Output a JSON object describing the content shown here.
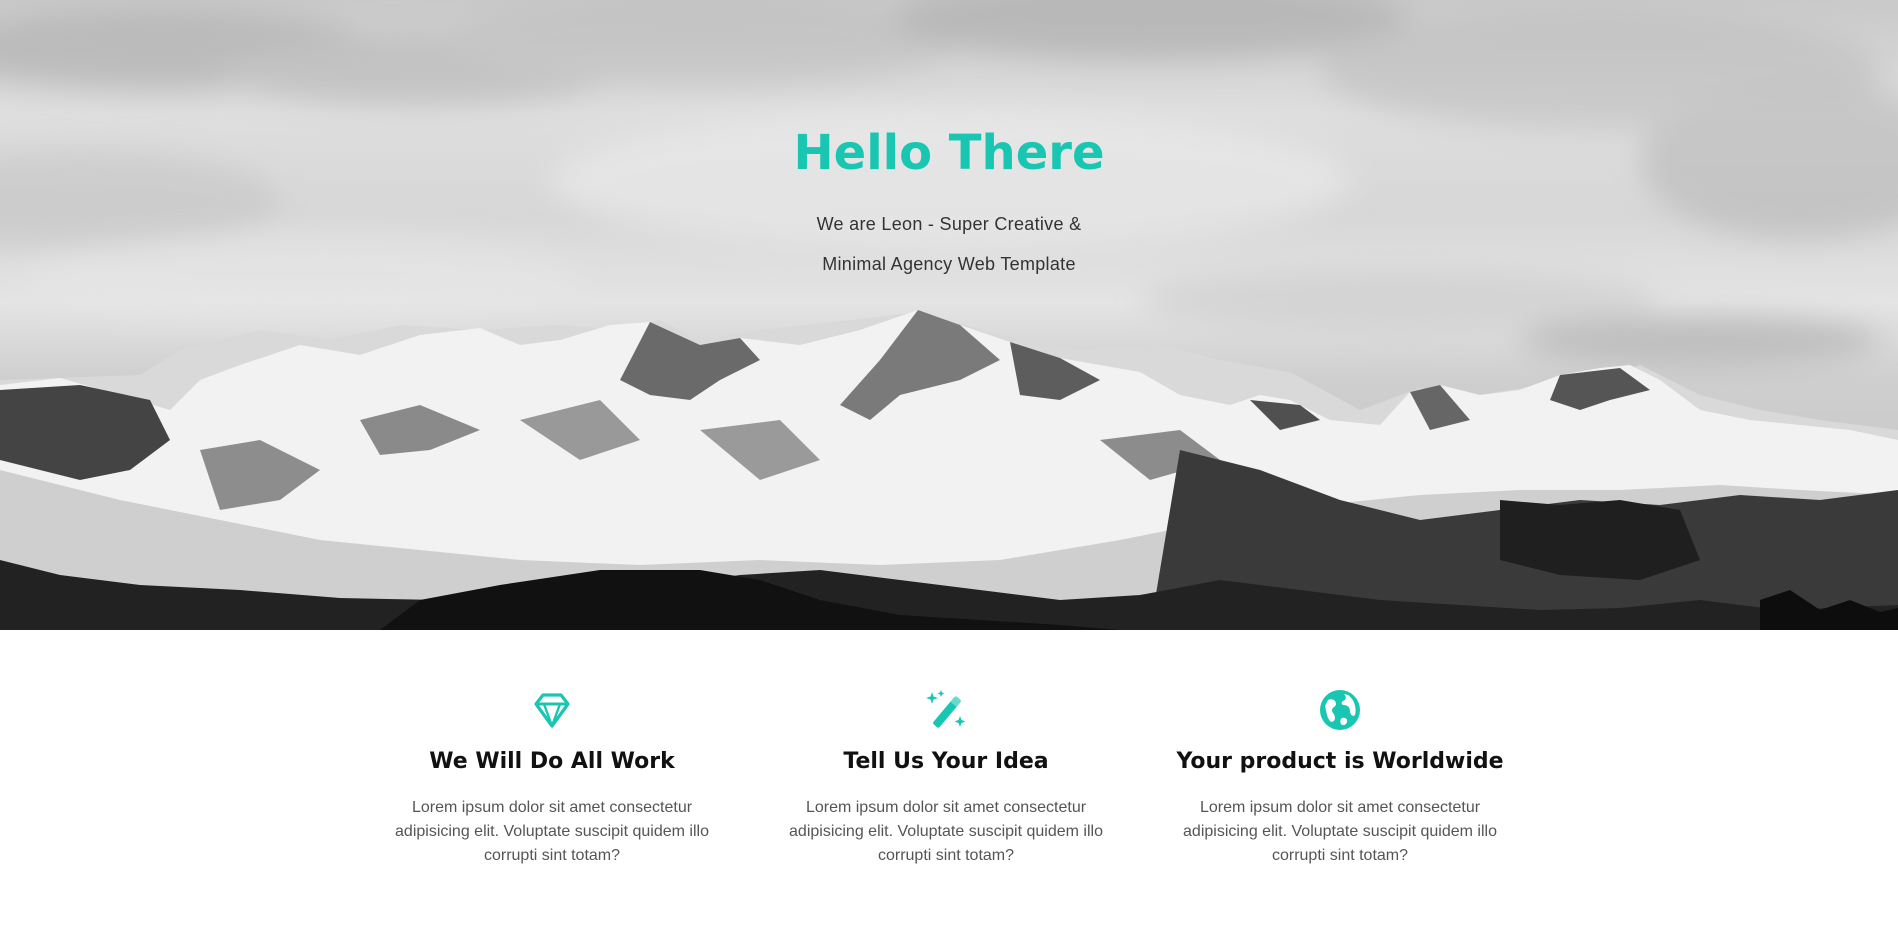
{
  "hero": {
    "title": "Hello There",
    "subtitle": "We are Leon - Super Creative & Minimal Agency Web Template",
    "accent_color": "#19c6b1"
  },
  "features": [
    {
      "icon": "diamond-icon",
      "title": "We Will Do All Work",
      "body": "Lorem ipsum dolor sit amet consectetur adipisicing elit. Voluptate suscipit quidem illo corrupti sint totam?"
    },
    {
      "icon": "magic-wand-icon",
      "title": "Tell Us Your Idea",
      "body": "Lorem ipsum dolor sit amet consectetur adipisicing elit. Voluptate suscipit quidem illo corrupti sint totam?"
    },
    {
      "icon": "globe-icon",
      "title": "Your product is Worldwide",
      "body": "Lorem ipsum dolor sit amet consectetur adipisicing elit. Voluptate suscipit quidem illo corrupti sint totam?"
    }
  ]
}
